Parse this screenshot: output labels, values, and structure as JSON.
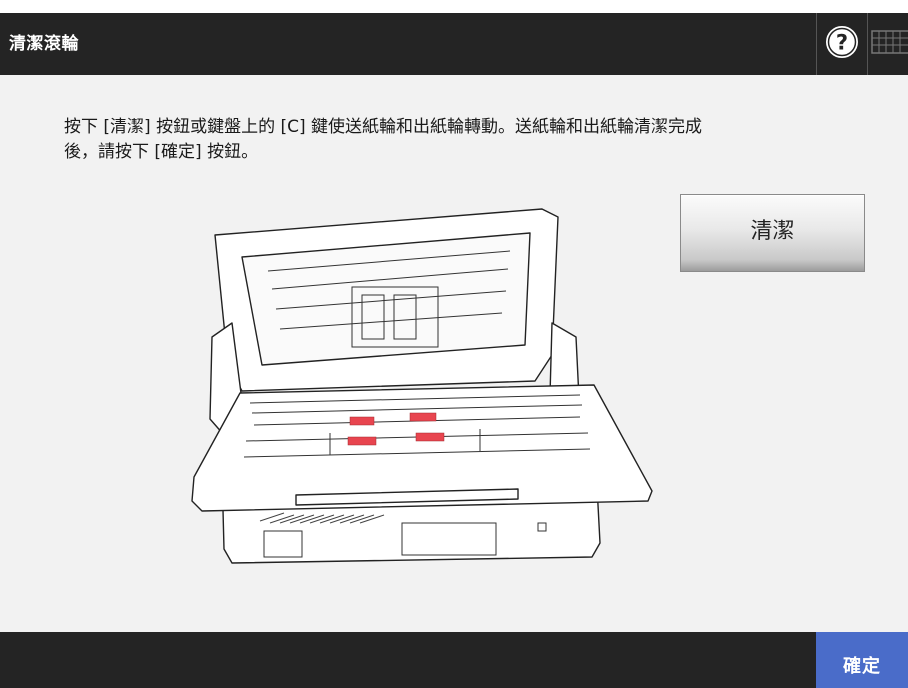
{
  "header": {
    "title": "清潔滾輪",
    "help_icon": "help-icon",
    "keyboard_icon": "keyboard-icon"
  },
  "main": {
    "instruction_line1": "按下 [清潔] 按鈕或鍵盤上的 [C] 鍵使送紙輪和出紙輪轉動。送紙輪和出紙輪清潔完成",
    "instruction_line2": "後，請按下 [確定] 按鈕。",
    "clean_button_label": "清潔",
    "illustration": "scanner-open-roller-illustration",
    "highlight_color": "#e8454f"
  },
  "footer": {
    "ok_button_label": "確定",
    "accent_color": "#4a6cc9"
  }
}
